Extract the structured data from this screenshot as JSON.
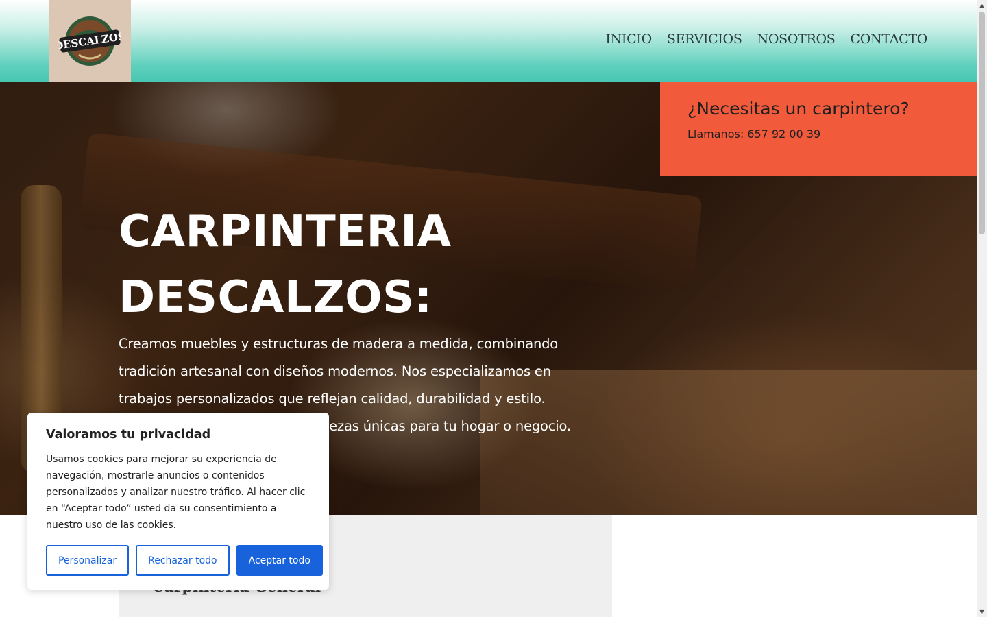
{
  "header": {
    "logo_text": "DESCALZOS",
    "nav": [
      "INICIO",
      "SERVICIOS",
      "NOSOTROS",
      "CONTACTO"
    ]
  },
  "callbox": {
    "question": "¿Necesitas un carpintero?",
    "phone_line": "Llamanos: 657 92 00 39"
  },
  "hero": {
    "title_line1": "CARPINTERIA",
    "title_line2": "DESCALZOS:",
    "text": "Creamos muebles y estructuras de madera a medida, combinando tradición artesanal con diseños modernos. Nos especializamos en trabajos personalizados que reflejan calidad, durabilidad y estilo. Confía en nosotros para crear piezas únicas para tu hogar o negocio."
  },
  "services": {
    "title": "Carpintería General"
  },
  "cookie": {
    "title": "Valoramos tu privacidad",
    "body": "Usamos cookies para mejorar su experiencia de navegación, mostrarle anuncios o contenidos personalizados y analizar nuestro tráfico. Al hacer clic en “Aceptar todo” usted da su consentimiento a nuestro uso de las cookies.",
    "customize": "Personalizar",
    "reject": "Rechazar todo",
    "accept": "Aceptar todo"
  },
  "colors": {
    "accent": "#f15b3c",
    "header_teal": "#47c6b1",
    "cookie_blue": "#1863dc"
  }
}
